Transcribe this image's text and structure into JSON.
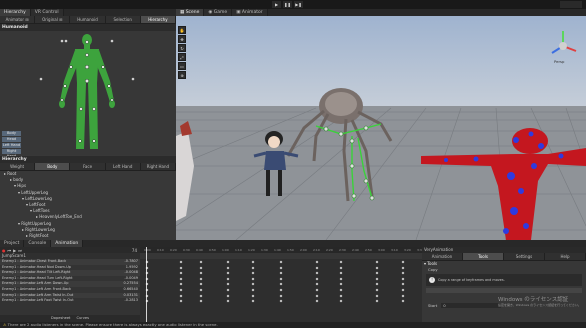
{
  "toolbar": {
    "play": "▶",
    "pause": "❚❚",
    "step": "▶❚"
  },
  "left": {
    "tabs": [
      "Hierarchy",
      "VR Control"
    ],
    "subtabs": [
      "Animator ⊞",
      "Original ⊞",
      "Humanoid",
      "Selection",
      "Hierarchy"
    ],
    "humanoid_header": "Humanoid",
    "body_buttons": [
      "Body",
      "Head",
      "Left Hand",
      "Right Hand"
    ],
    "hierarchy_header": "Hierarchy",
    "weight_tabs": [
      "Weight",
      "Body",
      "Face",
      "Left Hand",
      "Right Hand"
    ],
    "tree": [
      "Root",
      "body",
      "Hips",
      "LeftUpperLeg",
      "LeftLowerLeg",
      "LeftFoot",
      "LeftToes",
      "HeavenlyLeftToe_End",
      "RightUpperLeg",
      "RightLowerLeg",
      "RightFoot"
    ]
  },
  "scene": {
    "tabs": [
      "Scene",
      "Game",
      "Animator"
    ],
    "gizmo": "Persp",
    "accent": "#3d78d8"
  },
  "bottom": {
    "tabs": [
      "Project",
      "Console",
      "Animation"
    ],
    "clip": "JumpScare1",
    "frame": "74",
    "properties": [
      {
        "name": "Enemy1 : Animator.Chest Front-Back",
        "value": "-0.7807"
      },
      {
        "name": "Enemy1 : Animator.Head Nod Down-Up",
        "value": "1.9592"
      },
      {
        "name": "Enemy1 : Animator.Head Tilt Left-Right",
        "value": "-0.0048"
      },
      {
        "name": "Enemy1 : Animator.Head Turn Left-Right",
        "value": "-0.0049"
      },
      {
        "name": "Enemy1 : Animator.Left Arm Down-Up",
        "value": "0.27554"
      },
      {
        "name": "Enemy1 : Animator.Left Arm Front-Back",
        "value": "0.66540"
      },
      {
        "name": "Enemy1 : Animator.Left Arm Twist In-Out",
        "value": "0.03131"
      },
      {
        "name": "Enemy1 : Animator.Left Foot Twist In-Out",
        "value": "-0.2813"
      }
    ],
    "view_tabs": [
      "Dopesheet",
      "Curves"
    ],
    "ruler": [
      "0:00",
      "0:10",
      "0:20",
      "0:30",
      "0:40",
      "0:50",
      "1:00",
      "1:10",
      "1:20",
      "1:30",
      "1:40",
      "1:50",
      "2:00",
      "2:10",
      "2:20",
      "2:30",
      "2:40",
      "2:50",
      "3:00",
      "3:10",
      "3:20",
      "3:30"
    ],
    "right_panel": {
      "title": "VeryAnimation",
      "tabs": [
        "Animation",
        "Tools",
        "Settings",
        "Help"
      ],
      "section": "Tools",
      "copy": "Copy",
      "info": "Copy a range of keyframes and moves.",
      "start": "Start",
      "start_value": "0"
    }
  },
  "watermark": [
    "Windows のライセンス認証",
    "設定を開き、Windows のライセンス認証を行ってください。"
  ],
  "status": "There are 2 audio listeners in the scene. Please ensure there is always exactly one audio listener in the scene."
}
